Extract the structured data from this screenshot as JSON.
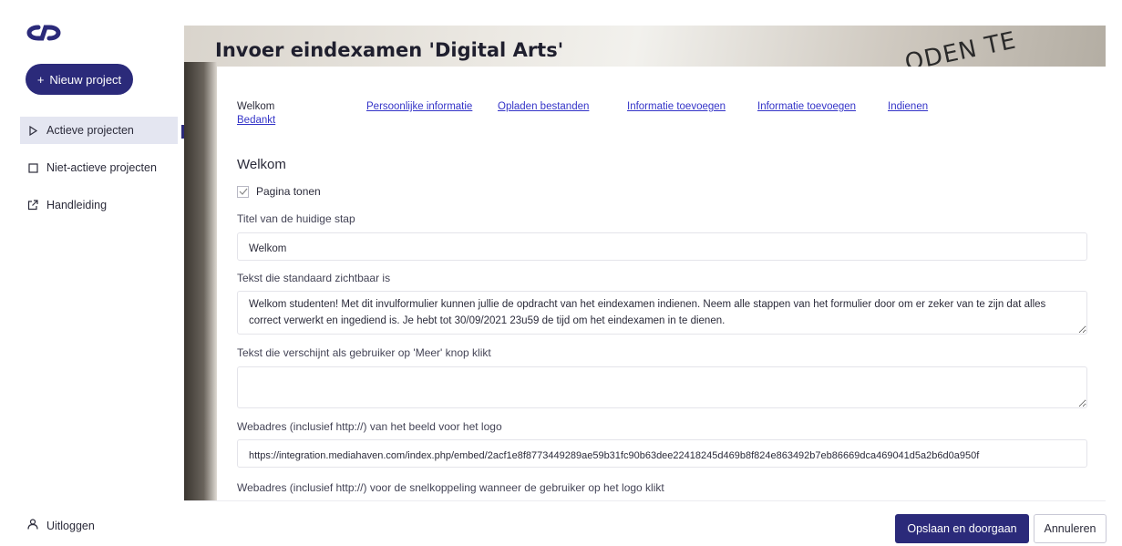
{
  "sidebar": {
    "logo": "logo-icon",
    "new_project_label": "Nieuw project",
    "items": [
      {
        "label": "Actieve projecten",
        "icon": "play-outline-icon",
        "active": true
      },
      {
        "label": "Niet-actieve projecten",
        "icon": "square-outline-icon",
        "active": false
      },
      {
        "label": "Handleiding",
        "icon": "external-link-icon",
        "active": false
      }
    ],
    "logout_label": "Uitloggen"
  },
  "header": {
    "title": "Invoer eindexamen 'Digital Arts'",
    "photo_text": "ODEN TE"
  },
  "steps": [
    {
      "label": "Welkom",
      "current": true
    },
    {
      "label": "Persoonlijke informatie",
      "current": false
    },
    {
      "label": "Opladen bestanden",
      "current": false
    },
    {
      "label": "Informatie toevoegen",
      "current": false
    },
    {
      "label": "Informatie toevoegen",
      "current": false
    },
    {
      "label": "Indienen",
      "current": false
    },
    {
      "label": "Bedankt",
      "current": false
    }
  ],
  "form": {
    "section_title": "Welkom",
    "show_page_label": "Pagina tonen",
    "show_page_checked": true,
    "step_title_label": "Titel van de huidige stap",
    "step_title_value": "Welkom",
    "default_text_label": "Tekst die standaard zichtbaar is",
    "default_text_value": "Welkom studenten! Met dit invulformulier kunnen jullie de opdracht van het eindexamen indienen. Neem alle stappen van het formulier door om er zeker van te zijn dat alles correct verwerkt en ingediend is. Je hebt tot 30/09/2021 23u59 de tijd om het eindexamen in te dienen.",
    "more_text_label": "Tekst die verschijnt als gebruiker op 'Meer' knop klikt",
    "more_text_value": "",
    "logo_url_label": "Webadres (inclusief http://) van het beeld voor het logo",
    "logo_url_value": "https://integration.mediahaven.com/index.php/embed/2acf1e8f8773449289ae59b31fc90b63dee22418245d469b8f824e863492b7eb86669dca469041d5a2b6d0a950f",
    "logo_link_label": "Webadres (inclusief http://) voor de snelkoppeling wanneer de gebruiker op het logo klikt"
  },
  "footer": {
    "save_label": "Opslaan en doorgaan",
    "cancel_label": "Annuleren"
  },
  "colors": {
    "primary": "#2b2a7a",
    "link": "#3434c8",
    "active_nav_bg": "#e4e6f1"
  }
}
